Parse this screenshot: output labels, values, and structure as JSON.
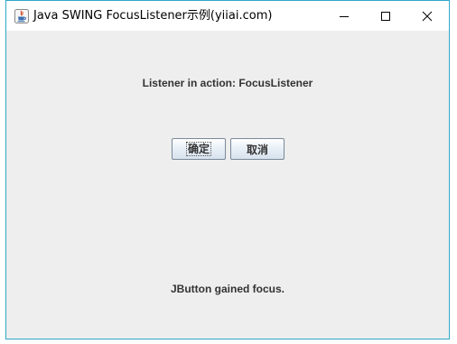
{
  "window": {
    "title": "Java SWING FocusListener示例(yiiai.com)",
    "icon": "java-cup-icon"
  },
  "window_controls": {
    "minimize_icon": "minimize-icon",
    "maximize_icon": "maximize-icon",
    "close_icon": "close-icon"
  },
  "content": {
    "header_label": "Listener in action: FocusListener",
    "ok_button_label": "确定",
    "cancel_button_label": "取消",
    "status_label": "JButton gained focus."
  },
  "colors": {
    "window_border": "#2fa8c9",
    "content_background": "#eeeeee",
    "label_text": "#333333"
  }
}
